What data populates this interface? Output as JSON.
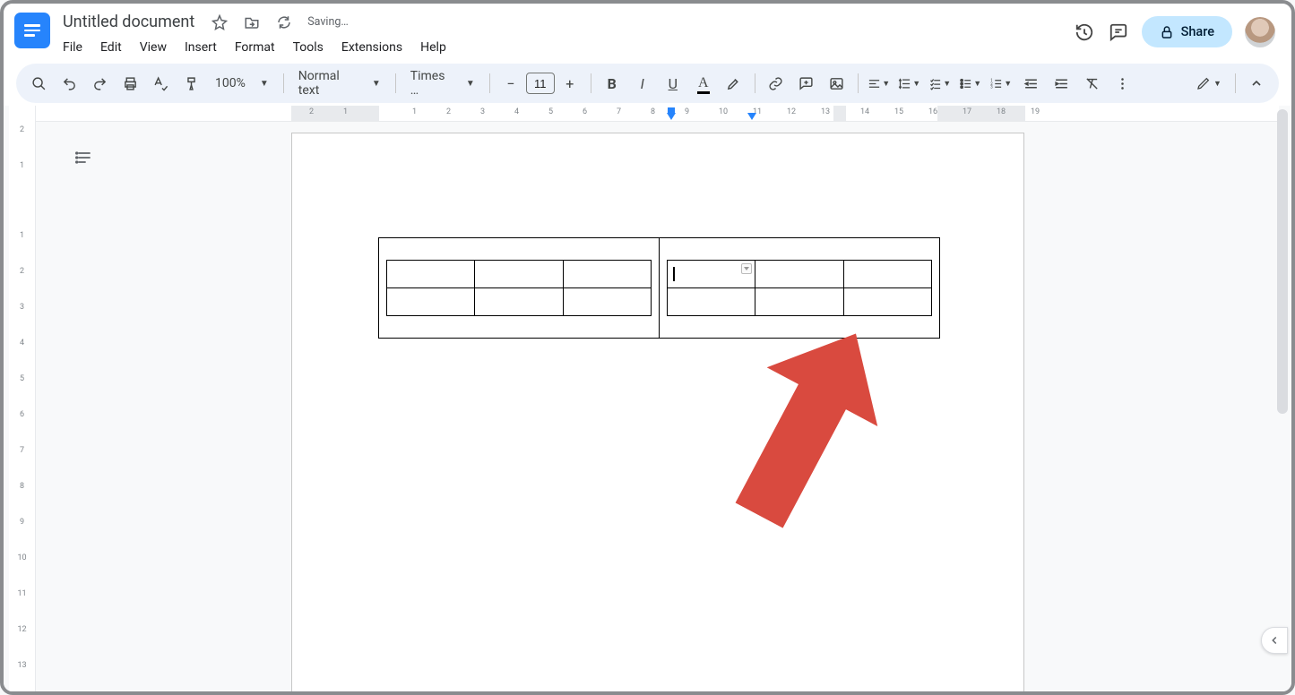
{
  "header": {
    "doc_title": "Untitled document",
    "saving_status": "Saving…",
    "share_label": "Share"
  },
  "menus": [
    "File",
    "Edit",
    "View",
    "Insert",
    "Format",
    "Tools",
    "Extensions",
    "Help"
  ],
  "toolbar": {
    "zoom": "100%",
    "style": "Normal text",
    "font": "Times …",
    "font_size": "11"
  },
  "ruler": {
    "horizontal": [
      "2",
      "1",
      "1",
      "2",
      "3",
      "4",
      "5",
      "6",
      "7",
      "8",
      "9",
      "10",
      "11",
      "12",
      "13",
      "14",
      "15",
      "16",
      "17",
      "18",
      "19"
    ],
    "vertical": [
      "2",
      "1",
      "1",
      "2",
      "3",
      "4",
      "5",
      "6",
      "7",
      "8",
      "9",
      "10",
      "11",
      "12",
      "13"
    ]
  },
  "annotation": {
    "arrow_color": "#d94a3f"
  }
}
